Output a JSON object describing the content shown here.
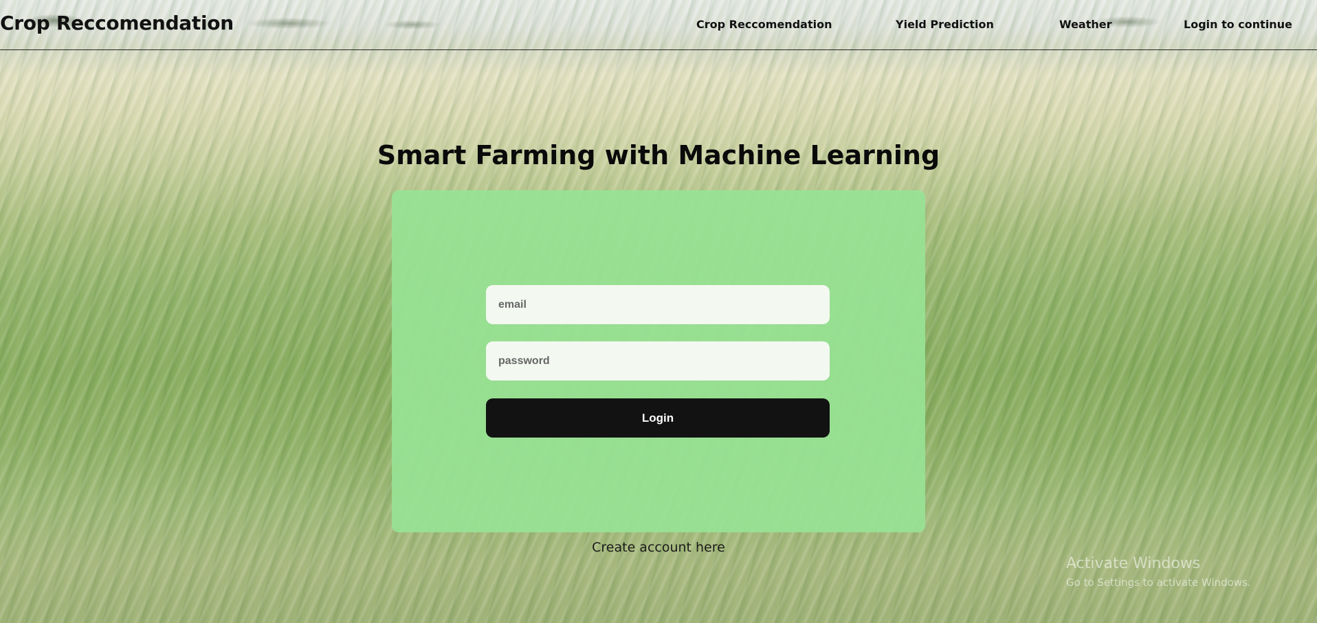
{
  "navbar": {
    "brand": "Crop Reccomendation",
    "links": [
      {
        "label": "Crop Reccomendation"
      },
      {
        "label": "Yield Prediction"
      },
      {
        "label": "Weather"
      },
      {
        "label": "Login to continue"
      }
    ]
  },
  "main": {
    "title": "Smart Farming with Machine Learning",
    "form": {
      "email_placeholder": "email",
      "password_placeholder": "password",
      "login_label": "Login"
    },
    "create_account_label": "Create account here"
  },
  "watermark": {
    "title": "Activate Windows",
    "subtitle": "Go to Settings to activate Windows."
  },
  "colors": {
    "card": "#98e294",
    "button": "#121212",
    "button_text": "#ffffff"
  }
}
